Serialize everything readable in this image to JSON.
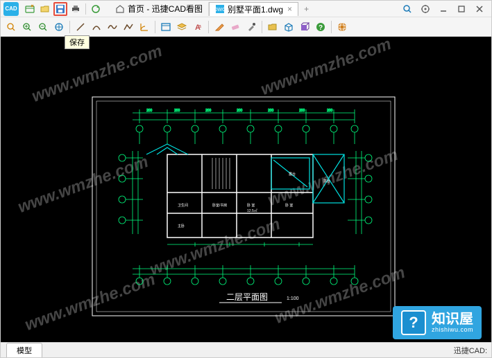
{
  "app": {
    "logo_text": "CAD"
  },
  "qat": {
    "save_tooltip": "保存"
  },
  "tabs": {
    "home": "首页 - 迅捷CAD看图",
    "file": "别墅平面1.dwg"
  },
  "statusbar": {
    "model_tab": "模型",
    "right_text": "迅捷CAD:"
  },
  "drawing": {
    "title": "二层平面图",
    "scale": "1:100"
  },
  "watermarks": {
    "w1": "www.wmzhe.com",
    "w2": "www.wmzhe.com",
    "w3": "www.wmzhe.com",
    "w4": "www.wmzhe.com",
    "w5": "www.wmzhe.com",
    "w6": "www.wmzhe.com",
    "w7": "www.wmzhe.com"
  },
  "brand": {
    "icon": "?",
    "main": "知识屋",
    "sub": "zhishiwu.com"
  }
}
